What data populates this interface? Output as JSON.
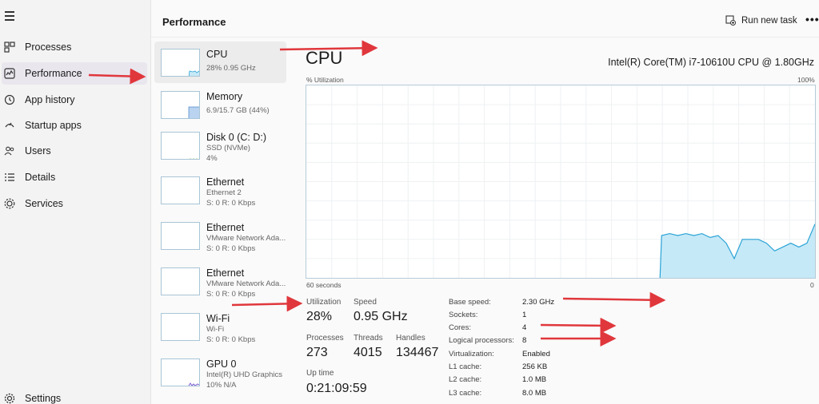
{
  "nav": {
    "items": [
      {
        "label": "Processes",
        "icon": "processes-icon"
      },
      {
        "label": "Performance",
        "icon": "performance-icon"
      },
      {
        "label": "App history",
        "icon": "app-history-icon"
      },
      {
        "label": "Startup apps",
        "icon": "startup-apps-icon"
      },
      {
        "label": "Users",
        "icon": "users-icon"
      },
      {
        "label": "Details",
        "icon": "details-icon"
      },
      {
        "label": "Services",
        "icon": "services-icon"
      }
    ],
    "settings_label": "Settings"
  },
  "header": {
    "title": "Performance",
    "run_task_label": "Run new task",
    "more_label": "•••"
  },
  "resources": [
    {
      "name": "CPU",
      "line1": "28%  0.95 GHz",
      "line2": ""
    },
    {
      "name": "Memory",
      "line1": "6.9/15.7 GB (44%)",
      "line2": ""
    },
    {
      "name": "Disk 0 (C: D:)",
      "line1": "SSD (NVMe)",
      "line2": "4%"
    },
    {
      "name": "Ethernet",
      "line1": "Ethernet 2",
      "line2": "S: 0  R: 0 Kbps"
    },
    {
      "name": "Ethernet",
      "line1": "VMware Network Ada...",
      "line2": "S: 0  R: 0 Kbps"
    },
    {
      "name": "Ethernet",
      "line1": "VMware Network Ada...",
      "line2": "S: 0  R: 0 Kbps"
    },
    {
      "name": "Wi-Fi",
      "line1": "Wi-Fi",
      "line2": "S: 0  R: 0 Kbps"
    },
    {
      "name": "GPU 0",
      "line1": "Intel(R) UHD Graphics",
      "line2": "10%  N/A"
    }
  ],
  "detail": {
    "title": "CPU",
    "model": "Intel(R) Core(TM) i7-10610U CPU @ 1.80GHz",
    "util_label": "% Utilization",
    "util_max": "100%",
    "time_label": "60 seconds",
    "time_zero": "0",
    "utilization_label": "Utilization",
    "utilization_value": "28%",
    "speed_label": "Speed",
    "speed_value": "0.95 GHz",
    "processes_label": "Processes",
    "processes_value": "273",
    "threads_label": "Threads",
    "threads_value": "4015",
    "handles_label": "Handles",
    "handles_value": "134467",
    "uptime_label": "Up time",
    "uptime_value": "0:21:09:59",
    "specs": [
      {
        "label": "Base speed:",
        "value": "2.30 GHz"
      },
      {
        "label": "Sockets:",
        "value": "1"
      },
      {
        "label": "Cores:",
        "value": "4"
      },
      {
        "label": "Logical processors:",
        "value": "8"
      },
      {
        "label": "Virtualization:",
        "value": "Enabled"
      },
      {
        "label": "L1 cache:",
        "value": "256 KB"
      },
      {
        "label": "L2 cache:",
        "value": "1.0 MB"
      },
      {
        "label": "L3 cache:",
        "value": "8.0 MB"
      }
    ]
  },
  "cpu_history_percent": [
    0,
    0,
    0,
    0,
    0,
    0,
    0,
    0,
    0,
    0,
    0,
    0,
    0,
    0,
    0,
    0,
    0,
    0,
    0,
    0,
    0,
    0,
    0,
    0,
    0,
    0,
    0,
    0,
    0,
    0,
    0,
    0,
    0,
    0,
    0,
    0,
    0,
    0,
    0,
    0,
    0,
    0,
    0,
    0,
    22,
    23,
    22,
    23,
    22,
    23,
    21,
    22,
    18,
    10,
    20,
    20,
    20,
    18,
    14,
    16,
    18,
    16,
    18,
    28
  ],
  "colors": {
    "graph_fill": "#c6e9f7",
    "graph_line": "#2aa3d6",
    "annotation_arrow": "#e0373c"
  }
}
